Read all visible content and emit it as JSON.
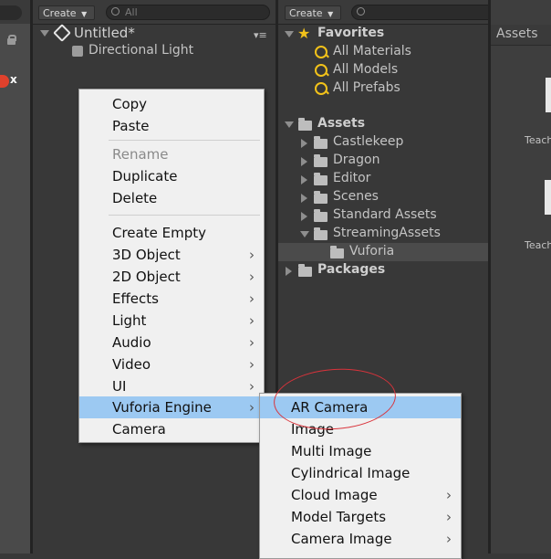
{
  "hierarchy": {
    "create_label": "Create",
    "search_placeholder": "All",
    "scene_name": "Untitled*",
    "items": [
      {
        "label": "Directional Light"
      }
    ]
  },
  "context_menu": {
    "items": [
      {
        "label": "Copy"
      },
      {
        "label": "Paste"
      },
      {
        "label": "Rename",
        "disabled": true
      },
      {
        "label": "Duplicate"
      },
      {
        "label": "Delete"
      },
      {
        "label": "Create Empty"
      },
      {
        "label": "3D Object",
        "submenu": true
      },
      {
        "label": "2D Object",
        "submenu": true
      },
      {
        "label": "Effects",
        "submenu": true
      },
      {
        "label": "Light",
        "submenu": true
      },
      {
        "label": "Audio",
        "submenu": true
      },
      {
        "label": "Video",
        "submenu": true
      },
      {
        "label": "UI",
        "submenu": true
      },
      {
        "label": "Vuforia Engine",
        "submenu": true,
        "highlighted": true
      },
      {
        "label": "Camera"
      }
    ],
    "submenu_arrow": "›"
  },
  "vuforia_submenu": {
    "items": [
      {
        "label": "AR Camera",
        "highlighted": true,
        "circled": true
      },
      {
        "label": "Image"
      },
      {
        "label": "Multi Image"
      },
      {
        "label": "Cylindrical Image"
      },
      {
        "label": "Cloud Image",
        "submenu": true
      },
      {
        "label": "Model Targets",
        "submenu": true
      },
      {
        "label": "Camera Image",
        "submenu": true
      }
    ]
  },
  "project": {
    "create_label": "Create",
    "favorites": {
      "label": "Favorites",
      "items": [
        {
          "label": "All Materials"
        },
        {
          "label": "All Models"
        },
        {
          "label": "All Prefabs"
        }
      ]
    },
    "assets": {
      "label": "Assets",
      "folders": [
        {
          "label": "Castlekeep"
        },
        {
          "label": "Dragon"
        },
        {
          "label": "Editor"
        },
        {
          "label": "Scenes"
        },
        {
          "label": "Standard Assets"
        },
        {
          "label": "StreamingAssets"
        }
      ],
      "streaming_child": "Vuforia"
    },
    "packages": {
      "label": "Packages"
    }
  },
  "assets_view": {
    "breadcrumb": "Assets",
    "thumb_labels": [
      "Teach",
      "Teach"
    ]
  },
  "colors": {
    "highlight": "#9cc9f2",
    "circle": "#d9333b",
    "favorite_star": "#f2c21a",
    "search_icon": "#f2c21a"
  }
}
